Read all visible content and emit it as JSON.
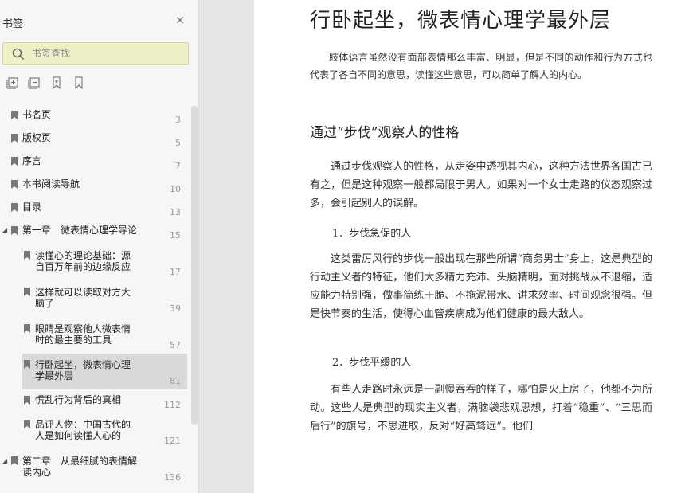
{
  "sidebar": {
    "title": "书签",
    "close_label": "×",
    "search": {
      "placeholder": "书签查找"
    },
    "items": [
      {
        "label": "书名页",
        "page": "3"
      },
      {
        "label": "版权页",
        "page": "5"
      },
      {
        "label": "序言",
        "page": "7"
      },
      {
        "label": "本书阅读导航",
        "page": "10"
      },
      {
        "label": "目录",
        "page": "13"
      },
      {
        "label": "第一章　微表情心理学导论",
        "page": "15"
      },
      {
        "label_lines": [
          "读懂心的理论基础：源",
          "自百万年前的边缘反应"
        ],
        "page": "17"
      },
      {
        "label_lines": [
          "这样就可以读取对方大",
          "脑了"
        ],
        "page": "39"
      },
      {
        "label_lines": [
          "眼睛是观察他人微表情",
          "时的最主要的工具"
        ],
        "page": "57"
      },
      {
        "label_lines": [
          "行卧起坐，微表情心理",
          "学最外层"
        ],
        "page": "81"
      },
      {
        "label": "慌乱行为背后的真相",
        "page": "112"
      },
      {
        "label_lines": [
          "品评人物：中国古代的",
          "人是如何读懂人心的"
        ],
        "page": "121"
      },
      {
        "label_lines": [
          "第二章　从最细腻的表情解",
          "读内心"
        ],
        "page": "136"
      }
    ]
  },
  "document": {
    "title": "行卧起坐，微表情心理学最外层",
    "intro": "肢体语言虽然没有面部表情那么丰富、明显，但是不同的动作和行为方式也代表了各自不同的意思，读懂这些意思，可以简单了解人的内心。",
    "section_heading": "通过“步伐”观察人的性格",
    "p1": "通过步伐观察人的性格，从走姿中透视其内心，这种方法世界各国古已有之，但是这种观察一般都局限于男人。如果对一个女士走路的仪态观察过多，会引起别人的误解。",
    "sub1": "1．步伐急促的人",
    "p2": "这类雷厉风行的步伐一般出现在那些所谓“商务男士”身上，这是典型的行动主义者的特征，他们大多精力充沛、头脑精明，面对挑战从不退缩，适应能力特别强，做事简练干脆、不拖泥带水、讲求效率、时间观念很强。但是快节奏的生活，使得心血管疾病成为他们健康的最大敌人。",
    "sub2": "2．步伐平缓的人",
    "p3": "有些人走路时永远是一副慢吞吞的样子，哪怕是火上房了，他都不为所动。这些人是典型的现实主义者，满脑袋悲观思想，打着“稳重”、“三思而后行”的旗号，不思进取，反对“好高骛远”。他们"
  }
}
